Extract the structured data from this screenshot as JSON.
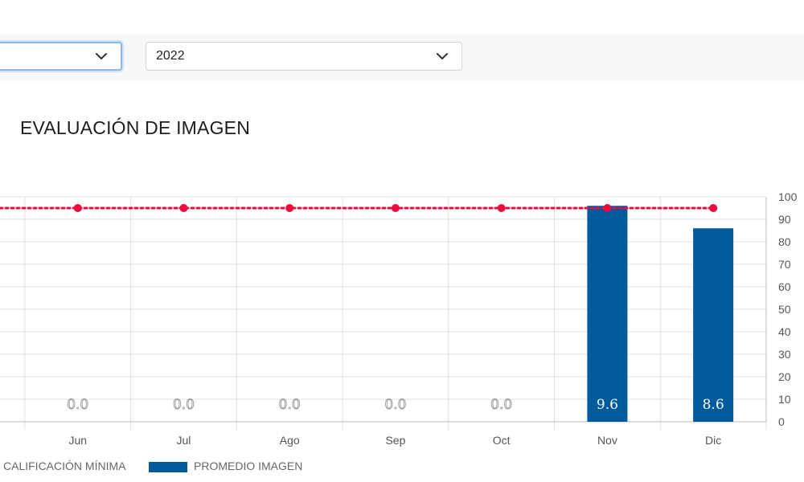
{
  "filters": {
    "first_select": {
      "value": ""
    },
    "year_select": {
      "value": "2022"
    }
  },
  "title": "EVALUACIÓN DE IMAGEN",
  "colors": {
    "bar": "#005a9c",
    "min_line": "#ee0a3c",
    "grid": "#e0e0e0"
  },
  "legend": {
    "min_label": "CALIFICACIÓN MÍNIMA",
    "bar_label": "PROMEDIO IMAGEN"
  },
  "chart_data": {
    "type": "bar",
    "categories": [
      "Jun",
      "Jul",
      "Ago",
      "Sep",
      "Oct",
      "Nov",
      "Dic"
    ],
    "series": [
      {
        "name": "PROMEDIO IMAGEN",
        "type": "bar",
        "values": [
          0,
          0,
          0,
          0,
          0,
          96,
          86
        ],
        "data_labels": [
          "0.0",
          "0.0",
          "0.0",
          "0.0",
          "0.0",
          "9.6",
          "8.6"
        ]
      },
      {
        "name": "CALIFICACIÓN MÍNIMA",
        "type": "line",
        "values": [
          95,
          95,
          95,
          95,
          95,
          95,
          95
        ]
      }
    ],
    "yticks": [
      "0",
      "10",
      "20",
      "30",
      "40",
      "50",
      "60",
      "70",
      "80",
      "90",
      "100"
    ],
    "ylim": [
      0,
      100
    ],
    "grid": true,
    "legend_position": "bottom"
  }
}
